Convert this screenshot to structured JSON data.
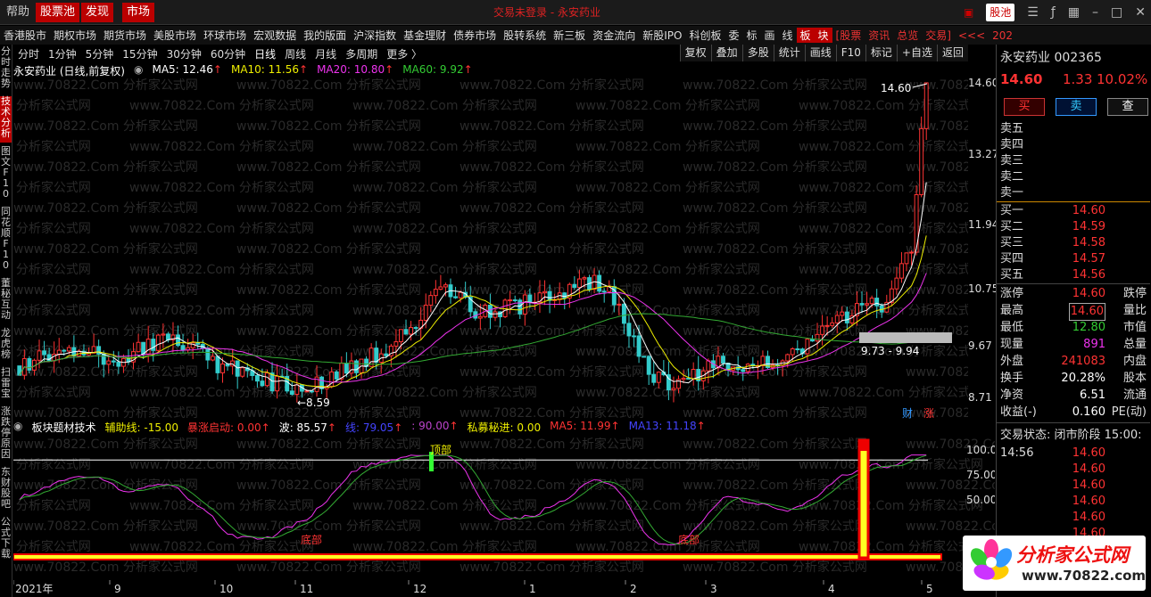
{
  "topbar": {
    "help": "帮助",
    "stock_pool": "股票池",
    "discover": "发现",
    "market": "市场",
    "window_title": "交易未登录 - 永安药业",
    "stockpool_btn": "股池"
  },
  "menu": [
    "香港股市",
    "期权市场",
    "期货市场",
    "美股市场",
    "环球市场",
    "宏观数据",
    "我的版面",
    "沪深指数",
    "基金理财",
    "债券市场",
    "股转系统",
    "新三板",
    "资金流向",
    "新股IPO",
    "科创板",
    "委",
    "标",
    "画",
    "线",
    "板",
    "块",
    "[股票",
    "资讯",
    "总览",
    "交易]",
    "<<<",
    "202"
  ],
  "lefttabs": [
    "分时走势",
    "技术分析",
    "图文F10",
    "同花顺F10",
    "董秘互动",
    "龙虎榜",
    "扫雷宝",
    "涨跌停原因",
    "东财股吧",
    "公式下载"
  ],
  "periods": [
    "分时",
    "1分钟",
    "5分钟",
    "15分钟",
    "30分钟",
    "60分钟",
    "日线",
    "周线",
    "月线",
    "多周期",
    "更多 〉"
  ],
  "tools": [
    "复权",
    "叠加",
    "多股",
    "统计",
    "画线",
    "F10",
    "标记",
    "+自选",
    "返回"
  ],
  "main": {
    "stock_label": "永安药业 (日线,前复权)",
    "ma5": "MA5: 12.46",
    "ma10": "MA10: 11.56",
    "ma20": "MA20: 10.80",
    "ma60": "MA60: 9.92",
    "high_label": "14.60",
    "low_label": "8.59",
    "range_label": "9.73 - 9.94",
    "badge_cai": "财",
    "badge_zhang": "涨"
  },
  "indicator": {
    "name": "板块题材技术",
    "aux": "辅助线: -15.00",
    "surge": "暴涨启动: 0.00",
    "wave": "波: 85.57",
    "mid": "线: 79.05",
    "val90": ": 90.00",
    "private": "私募秘进: 0.00",
    "ma5": "MA5: 11.99",
    "ma13": "MA13: 11.18",
    "top_label": "顶部",
    "bottom_label1": "底部",
    "bottom_label2": "底部"
  },
  "watermark": "www.70822.Com 分析家公式网",
  "price_ticks": [
    "14.60",
    "13.27",
    "11.94",
    "10.75",
    "9.67",
    "8.71"
  ],
  "ind_ticks": [
    "100.0",
    "75.00",
    "50.00"
  ],
  "date_ticks": [
    "2021年",
    "9",
    "10",
    "11",
    "12",
    "1",
    "2",
    "3",
    "4",
    "5"
  ],
  "quote": {
    "title": "永安药业 002365",
    "price": "14.60",
    "change": "1.33",
    "pct": "10.02%",
    "buy_btn": "买",
    "sell_btn": "卖",
    "query_btn": "查",
    "asks": [
      {
        "label": "卖五",
        "price": ""
      },
      {
        "label": "卖四",
        "price": ""
      },
      {
        "label": "卖三",
        "price": ""
      },
      {
        "label": "卖二",
        "price": ""
      },
      {
        "label": "卖一",
        "price": ""
      }
    ],
    "bids": [
      {
        "label": "买一",
        "price": "14.60"
      },
      {
        "label": "买二",
        "price": "14.59"
      },
      {
        "label": "买三",
        "price": "14.58"
      },
      {
        "label": "买四",
        "price": "14.57"
      },
      {
        "label": "买五",
        "price": "14.56"
      }
    ],
    "stats": [
      {
        "l": "涨停",
        "v": "14.60",
        "r": "跌停",
        "c": "red"
      },
      {
        "l": "最高",
        "v": "14.60",
        "r": "量比",
        "c": "red"
      },
      {
        "l": "最低",
        "v": "12.80",
        "r": "市值",
        "c": "green"
      },
      {
        "l": "现量",
        "v": "891",
        "r": "总量",
        "c": "magenta"
      },
      {
        "l": "外盘",
        "v": "241083",
        "r": "内盘",
        "c": "red"
      },
      {
        "l": "换手",
        "v": "20.28%",
        "r": "股本",
        "c": "white"
      },
      {
        "l": "净资",
        "v": "6.51",
        "r": "流通",
        "c": "white"
      },
      {
        "l": "收益(-)",
        "v": "0.160",
        "r": "PE(动)",
        "c": "white"
      }
    ],
    "trade_status": "交易状态: 闭市阶段 15:00:",
    "ticks_time": "14:56",
    "ticks": [
      "14.60",
      "14.60",
      "14.60",
      "14.60",
      "14.60",
      "14.60",
      "14.60"
    ]
  },
  "logo": {
    "title": "分析家公式网",
    "url": "www.70822.com"
  },
  "colors": {
    "up": "#ff3333",
    "down": "#33cccc",
    "ma5": "#ffffff",
    "ma10": "#eeee00",
    "ma20": "#ee33ee",
    "ma60": "#33aa33"
  }
}
